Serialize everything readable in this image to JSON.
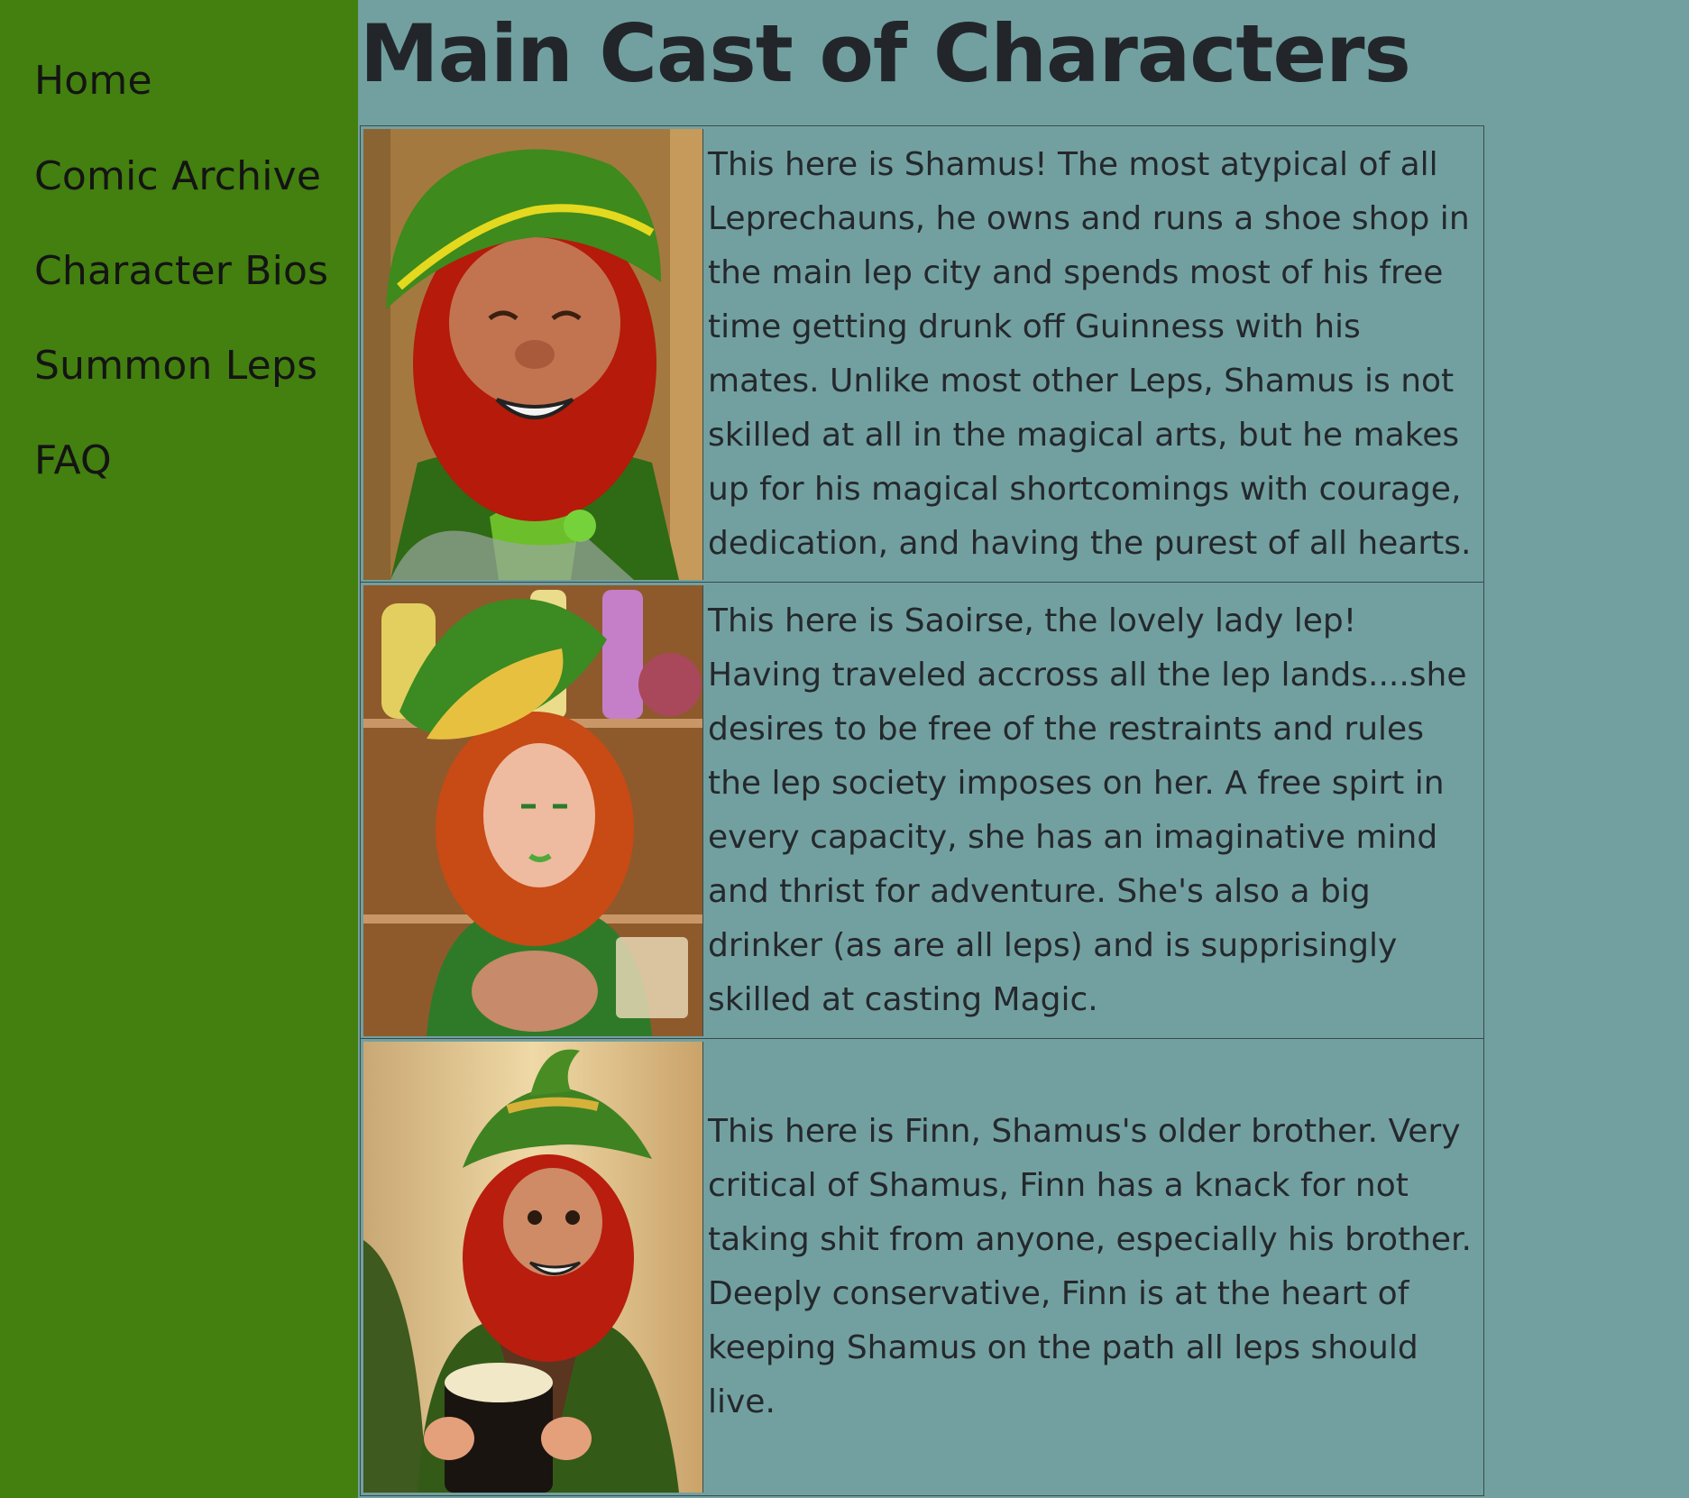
{
  "sidebar": {
    "items": [
      {
        "label": "Home"
      },
      {
        "label": "Comic Archive"
      },
      {
        "label": "Character Bios"
      },
      {
        "label": "Summon Leps"
      },
      {
        "label": "FAQ"
      }
    ]
  },
  "main": {
    "title": "Main Cast of Characters",
    "characters": [
      {
        "portrait_icon": "leprechaun-shamus-portrait",
        "bio": "This here is Shamus! The most atypical of all Leprechauns, he owns and runs a shoe shop in the main lep city and spends most of his free time getting drunk off Guinness with his mates. Unlike most other Leps, Shamus is not skilled at all in the magical arts, but he makes up for his magical shortcomings with courage, dedication, and having the purest of all hearts."
      },
      {
        "portrait_icon": "leprechaun-saoirse-portrait",
        "bio": "This here is Saoirse, the lovely lady lep! Having traveled accross all the lep lands....she desires to be free of the restraints and rules the lep society imposes on her. A free spirt in every capacity, she has an imaginative mind and thrist for adventure. She's also a big drinker (as are all leps) and is supprisingly skilled at casting Magic."
      },
      {
        "portrait_icon": "leprechaun-finn-portrait",
        "bio": "This here is Finn, Shamus's older brother. Very critical of Shamus, Finn has a knack for not taking shit from anyone, especially his brother. Deeply conservative, Finn is at the heart of keeping Shamus on the path all leps should live."
      }
    ]
  },
  "colors": {
    "sidebar_bg": "#43800f",
    "main_bg": "#72a0a0",
    "text": "#24282c"
  }
}
